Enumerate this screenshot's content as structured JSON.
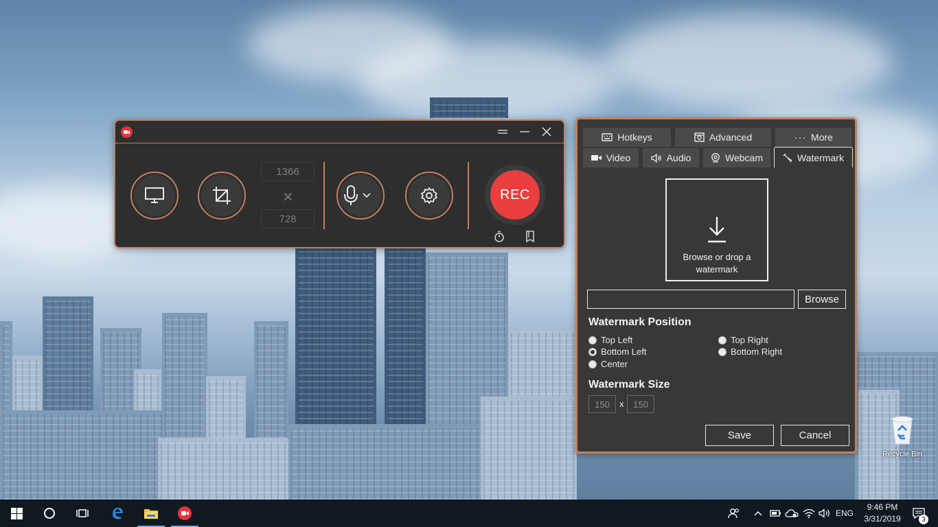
{
  "recorder": {
    "width_value": "1366",
    "height_value": "728",
    "times_symbol": "✕",
    "rec_label": "REC"
  },
  "settings": {
    "tabs_row1": [
      {
        "label": "Hotkeys",
        "icon": "keyboard-icon"
      },
      {
        "label": "Advanced",
        "icon": "advanced-settings-icon"
      },
      {
        "label": "More",
        "icon": "ellipsis-icon"
      }
    ],
    "tabs_row2": [
      {
        "label": "Video",
        "icon": "video-camera-icon"
      },
      {
        "label": "Audio",
        "icon": "speaker-icon"
      },
      {
        "label": "Webcam",
        "icon": "webcam-icon"
      },
      {
        "label": "Watermark",
        "icon": "watermark-icon",
        "active": true
      }
    ],
    "drop_zone_text": "Browse or drop a watermark",
    "path_value": "",
    "browse_label": "Browse",
    "position_title": "Watermark Position",
    "positions": [
      {
        "label": "Top Left",
        "checked": false
      },
      {
        "label": "Top Right",
        "checked": false
      },
      {
        "label": "Bottom Left",
        "checked": true
      },
      {
        "label": "Bottom Right",
        "checked": false
      },
      {
        "label": "Center",
        "checked": false
      }
    ],
    "size_title": "Watermark Size",
    "size_width": "150",
    "size_height": "150",
    "size_separator": "x",
    "save_label": "Save",
    "cancel_label": "Cancel"
  },
  "desktop": {
    "recycle_bin_label": "Recycle Bin"
  },
  "taskbar": {
    "language": "ENG",
    "time": "9:46 PM",
    "date": "3/31/2019",
    "notification_count": "3"
  },
  "colors": {
    "accent_orange": "#c1815d",
    "record_red": "#e93f3f",
    "panel_dark": "#2e2e2e"
  }
}
